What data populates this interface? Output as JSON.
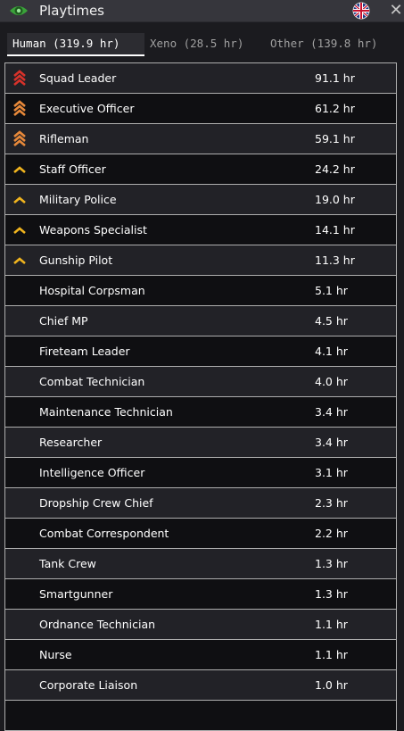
{
  "window": {
    "title": "Playtimes",
    "icon": "eye-icon",
    "accent_color": "#3aa33a"
  },
  "tabs": [
    {
      "label": "Human (319.9 hr)",
      "active": true
    },
    {
      "label": "Xeno (28.5 hr)",
      "active": false
    },
    {
      "label": "Other (139.8 hr)",
      "active": false
    }
  ],
  "rank_colors": {
    "red": "#d8322a",
    "orange": "#e8893a",
    "yellow": "#f0b41e"
  },
  "rows": [
    {
      "name": "Squad Leader",
      "time": "91.1 hr",
      "rank": "red"
    },
    {
      "name": "Executive Officer",
      "time": "61.2 hr",
      "rank": "orange"
    },
    {
      "name": "Rifleman",
      "time": "59.1 hr",
      "rank": "orange"
    },
    {
      "name": "Staff Officer",
      "time": "24.2 hr",
      "rank": "yellow"
    },
    {
      "name": "Military Police",
      "time": "19.0 hr",
      "rank": "yellow"
    },
    {
      "name": "Weapons Specialist",
      "time": "14.1 hr",
      "rank": "yellow"
    },
    {
      "name": "Gunship Pilot",
      "time": "11.3 hr",
      "rank": "yellow"
    },
    {
      "name": "Hospital Corpsman",
      "time": "5.1 hr",
      "rank": ""
    },
    {
      "name": "Chief MP",
      "time": "4.5 hr",
      "rank": ""
    },
    {
      "name": "Fireteam Leader",
      "time": "4.1 hr",
      "rank": ""
    },
    {
      "name": "Combat Technician",
      "time": "4.0 hr",
      "rank": ""
    },
    {
      "name": "Maintenance Technician",
      "time": "3.4 hr",
      "rank": ""
    },
    {
      "name": "Researcher",
      "time": "3.4 hr",
      "rank": ""
    },
    {
      "name": "Intelligence Officer",
      "time": "3.1 hr",
      "rank": ""
    },
    {
      "name": "Dropship Crew Chief",
      "time": "2.3 hr",
      "rank": ""
    },
    {
      "name": "Combat Correspondent",
      "time": "2.2 hr",
      "rank": ""
    },
    {
      "name": "Tank Crew",
      "time": "1.3 hr",
      "rank": ""
    },
    {
      "name": "Smartgunner",
      "time": "1.3 hr",
      "rank": ""
    },
    {
      "name": "Ordnance Technician",
      "time": "1.1 hr",
      "rank": ""
    },
    {
      "name": "Nurse",
      "time": "1.1 hr",
      "rank": ""
    },
    {
      "name": "Corporate Liaison",
      "time": "1.0 hr",
      "rank": ""
    },
    {
      "name": "",
      "time": "",
      "rank": ""
    }
  ]
}
